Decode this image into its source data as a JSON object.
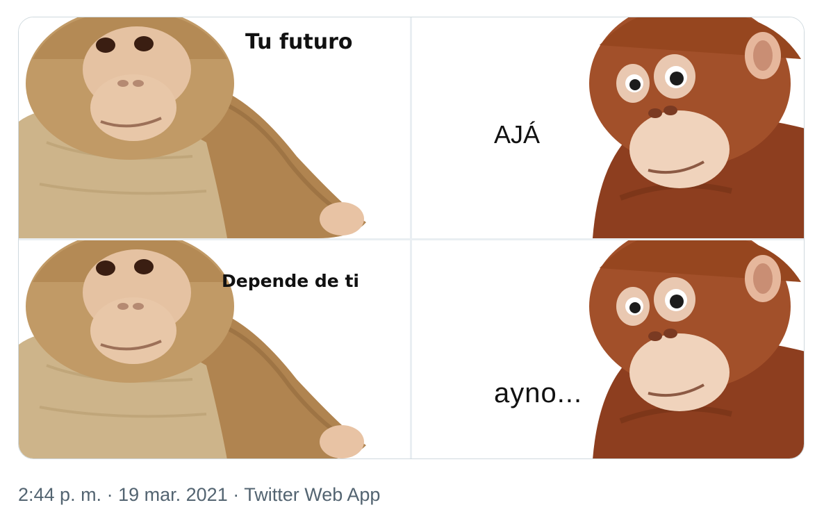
{
  "meme": {
    "panels": [
      {
        "caption": "Tu futuro"
      },
      {
        "caption": "AJÁ"
      },
      {
        "caption": "Depende de ti"
      },
      {
        "caption": "ayno..."
      }
    ]
  },
  "tweet": {
    "time": "2:44 p. m.",
    "separator": "·",
    "date": "19 mar. 2021",
    "source": "Twitter Web App"
  },
  "colors": {
    "border": "#cfd9de",
    "meta_text": "#536471",
    "beige_monkey": "#c9a878",
    "orange_monkey": "#a2502a"
  },
  "icons": {
    "beige_monkey": "plush-monkey-beige",
    "orange_monkey": "plush-orangutan"
  }
}
